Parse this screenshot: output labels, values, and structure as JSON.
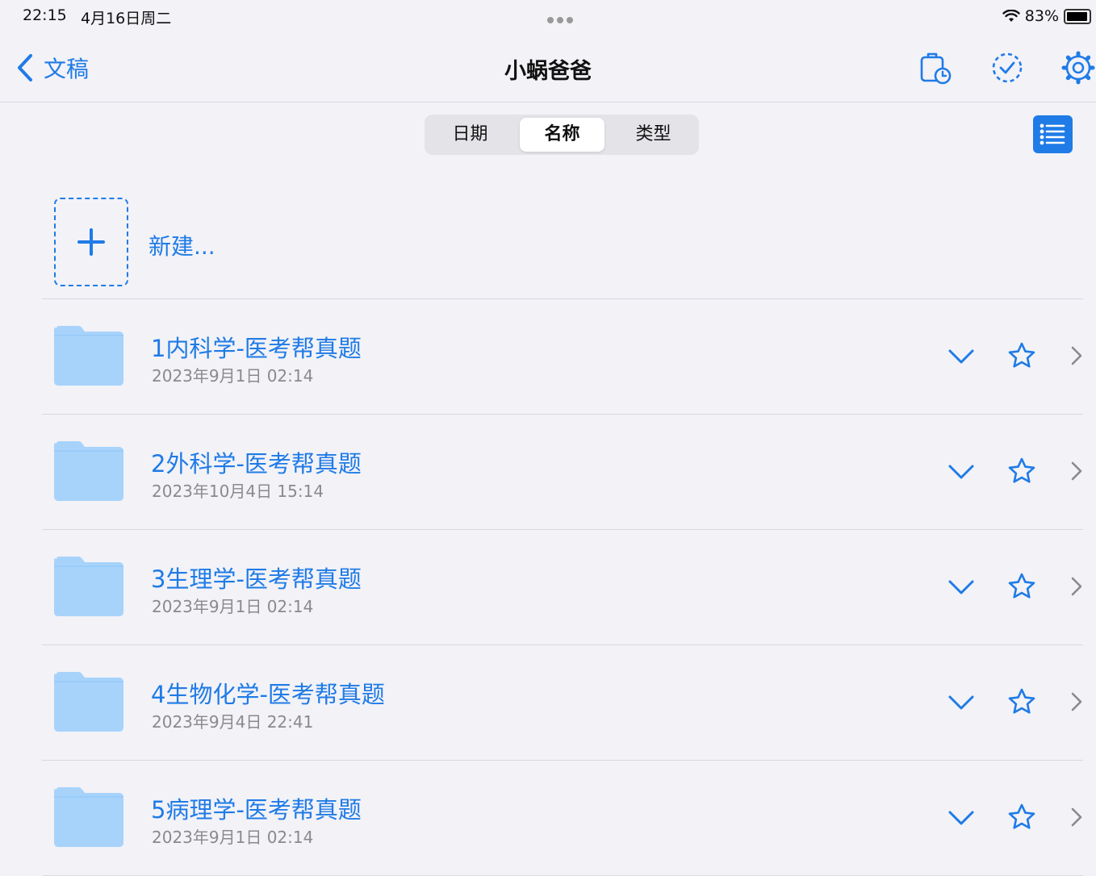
{
  "status": {
    "time": "22:15",
    "date": "4月16日周二",
    "battery": "83%",
    "battery_level": 0.83
  },
  "nav": {
    "back_label": "文稿",
    "title": "小蜗爸爸",
    "icons": [
      "recent-docs-icon",
      "select-icon",
      "settings-icon"
    ]
  },
  "sort": {
    "options": [
      "日期",
      "名称",
      "类型"
    ],
    "selected": "名称"
  },
  "new_item": {
    "label": "新建..."
  },
  "folders": [
    {
      "name": "1内科学-医考帮真题",
      "date": "2023年9月1日 02:14"
    },
    {
      "name": "2外科学-医考帮真题",
      "date": "2023年10月4日 15:14"
    },
    {
      "name": "3生理学-医考帮真题",
      "date": "2023年9月1日 02:14"
    },
    {
      "name": "4生物化学-医考帮真题",
      "date": "2023年9月4日 22:41"
    },
    {
      "name": "5病理学-医考帮真题",
      "date": "2023年9月1日 02:14"
    }
  ],
  "colors": {
    "accent": "#1f7be6",
    "folder": "#a7d3fb",
    "background": "#f2f2f7"
  }
}
